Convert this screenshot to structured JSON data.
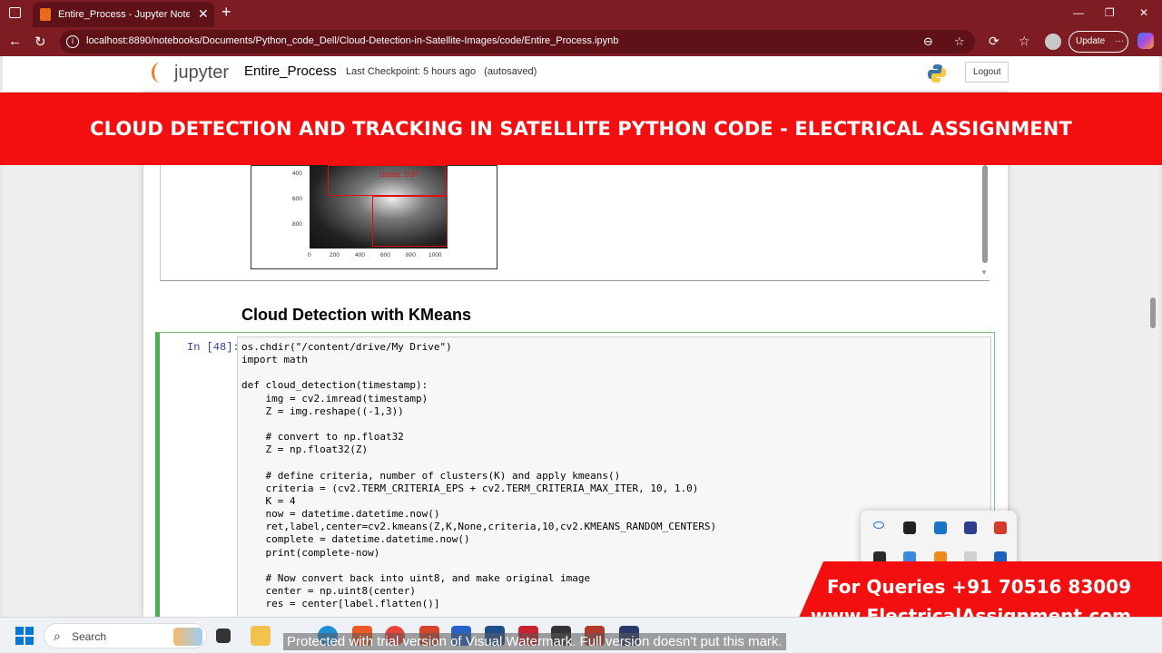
{
  "browser": {
    "tab_title": "Entire_Process - Jupyter Notebook",
    "new_tab": "+",
    "url": "localhost:8890/notebooks/Documents/Python_code_Dell/Cloud-Detection-in-Satellite-Images/code/Entire_Process.ipynb",
    "update_label": "Update",
    "update_more": "···"
  },
  "jupyter": {
    "logo_text": "jupyter",
    "notebook_name": "Entire_Process",
    "checkpoint": "Last Checkpoint: 5 hours ago",
    "autosave": "(autosaved)",
    "logout_label": "Logout"
  },
  "banner": {
    "title": "CLOUD DETECTION AND TRACKING IN SATELLITE PYTHON CODE - ELECTRICAL ASSIGNMENT"
  },
  "plot": {
    "yticks": [
      "400",
      "600",
      "800"
    ],
    "xticks": [
      "0",
      "200",
      "400",
      "600",
      "800",
      "1000"
    ],
    "labels": [
      "cloudy: 0.97"
    ]
  },
  "section_heading": "Cloud Detection with KMeans",
  "cell": {
    "prompt": "In [48]:",
    "code": "os.chdir(\"/content/drive/My Drive\")\nimport math\n\ndef cloud_detection(timestamp):\n    img = cv2.imread(timestamp)\n    Z = img.reshape((-1,3))\n\n    # convert to np.float32\n    Z = np.float32(Z)\n\n    # define criteria, number of clusters(K) and apply kmeans()\n    criteria = (cv2.TERM_CRITERIA_EPS + cv2.TERM_CRITERIA_MAX_ITER, 10, 1.0)\n    K = 4\n    now = datetime.datetime.now()\n    ret,label,center=cv2.kmeans(Z,K,None,criteria,10,cv2.KMEANS_RANDOM_CENTERS)\n    complete = datetime.datetime.now()\n    print(complete-now)\n\n    # Now convert back into uint8, and make original image\n    center = np.uint8(center)\n    res = center[label.flatten()]"
  },
  "contact": {
    "line1": "For Queries +91 70516 83009",
    "line2": "www.ElectricalAssignment.com"
  },
  "taskbar": {
    "search_label": "Search"
  },
  "watermark": "Protected with trial version of Visual Watermark. Full version doesn't put this mark.",
  "colors": {
    "browser_chrome": "#7d1c22",
    "banner_red": "#f30f0f",
    "cell_border": "#4caf50",
    "prompt_blue": "#303f9f"
  }
}
